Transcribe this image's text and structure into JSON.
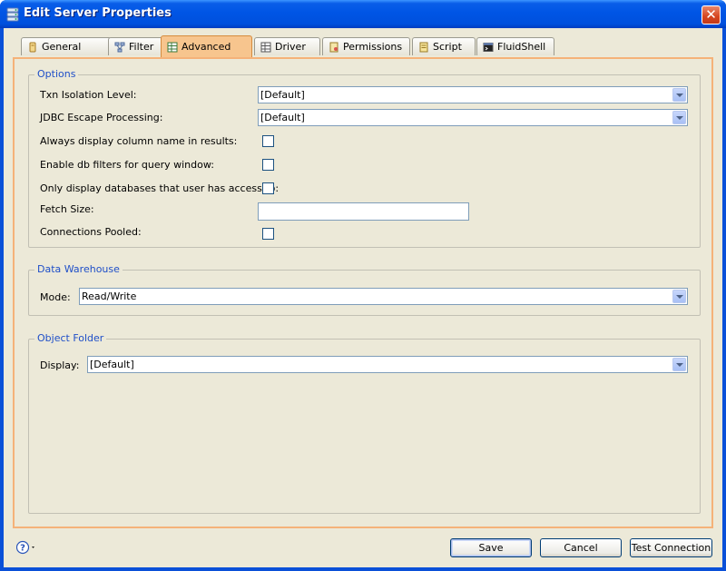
{
  "window": {
    "title": "Edit Server Properties"
  },
  "tabs": [
    {
      "label": "General",
      "icon": "general-icon",
      "active": false
    },
    {
      "label": "Filter",
      "icon": "filter-icon",
      "active": false
    },
    {
      "label": "Advanced",
      "icon": "advanced-icon",
      "active": true
    },
    {
      "label": "Driver",
      "icon": "driver-icon",
      "active": false
    },
    {
      "label": "Permissions",
      "icon": "permissions-icon",
      "active": false
    },
    {
      "label": "Script",
      "icon": "script-icon",
      "active": false
    },
    {
      "label": "FluidShell",
      "icon": "fluidshell-icon",
      "active": false
    }
  ],
  "options": {
    "legend": "Options",
    "txn_label": "Txn Isolation Level:",
    "txn_value": "[Default]",
    "jdbc_label": "JDBC Escape Processing:",
    "jdbc_value": "[Default]",
    "colname_label": "Always display column name in results:",
    "dbfilters_label": "Enable db filters for query window:",
    "onlydb_label": "Only display databases that user has access to:",
    "fetch_label": "Fetch Size:",
    "fetch_value": "",
    "pooled_label": "Connections Pooled:"
  },
  "warehouse": {
    "legend": "Data Warehouse",
    "mode_label": "Mode:",
    "mode_value": "Read/Write"
  },
  "object_folder": {
    "legend": "Object Folder",
    "display_label": "Display:",
    "display_value": "[Default]"
  },
  "buttons": {
    "save": "Save",
    "cancel": "Cancel",
    "test": "Test Connection"
  }
}
